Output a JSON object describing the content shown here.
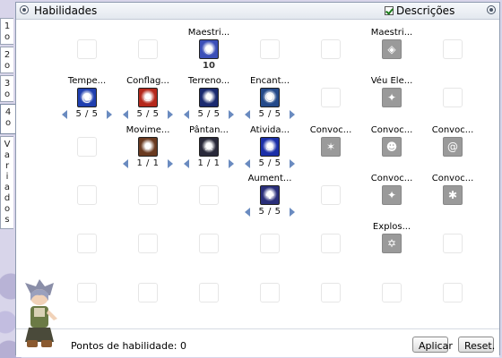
{
  "window": {
    "title": "Habilidades",
    "descricoes_label": "Descrições",
    "descricoes_checked": true
  },
  "tabs": [
    {
      "label": "1o"
    },
    {
      "label": "2o"
    },
    {
      "label": "3o"
    },
    {
      "label": "4o"
    },
    {
      "label": "Variados"
    }
  ],
  "skills": [
    {
      "name": "Maestri...",
      "level_text": "10",
      "icon": "sphere-icon",
      "color": "#3b4fb8",
      "active": true,
      "mode": "single"
    },
    {
      "name": "Maestri...",
      "level_text": "",
      "icon": "diamond-emblem-icon",
      "color": "#9a9a9a",
      "active": false,
      "mode": "none"
    },
    {
      "name": "Tempe...",
      "level_text": "5 / 5",
      "icon": "vortex-icon",
      "color": "#1f3fb0",
      "active": true,
      "mode": "range"
    },
    {
      "name": "Conflag...",
      "level_text": "5 / 5",
      "icon": "fire-icon",
      "color": "#b5281b",
      "active": true,
      "mode": "range"
    },
    {
      "name": "Terreno...",
      "level_text": "5 / 5",
      "icon": "lightning-icon",
      "color": "#1a2a70",
      "active": true,
      "mode": "range"
    },
    {
      "name": "Encant...",
      "level_text": "5 / 5",
      "icon": "spirit-icon",
      "color": "#244a8a",
      "active": true,
      "mode": "range"
    },
    {
      "name": "Véu Ele...",
      "level_text": "",
      "icon": "star-burst-icon",
      "color": "#9a9a9a",
      "active": false,
      "mode": "none"
    },
    {
      "name": "Movime...",
      "level_text": "1 / 1",
      "icon": "movement-icon",
      "color": "#6a3a20",
      "active": true,
      "mode": "range"
    },
    {
      "name": "Pântan...",
      "level_text": "1 / 1",
      "icon": "skull-icon",
      "color": "#2a2a3a",
      "active": true,
      "mode": "range"
    },
    {
      "name": "Ativida...",
      "level_text": "5 / 5",
      "icon": "blue-flame-icon",
      "color": "#1b2fa8",
      "active": true,
      "mode": "range"
    },
    {
      "name": "Convoc...",
      "level_text": "",
      "icon": "summon-fire-icon",
      "color": "#9a9a9a",
      "active": false,
      "mode": "none"
    },
    {
      "name": "Convoc...",
      "level_text": "",
      "icon": "summon-face-icon",
      "color": "#9a9a9a",
      "active": false,
      "mode": "none"
    },
    {
      "name": "Convoc...",
      "level_text": "",
      "icon": "summon-swirl-icon",
      "color": "#9a9a9a",
      "active": false,
      "mode": "none"
    },
    {
      "name": "Aument...",
      "level_text": "5 / 5",
      "icon": "cross-sparkle-icon",
      "color": "#2a2f7a",
      "active": true,
      "mode": "range"
    },
    {
      "name": "Convoc...",
      "level_text": "",
      "icon": "summon-rock-icon",
      "color": "#9a9a9a",
      "active": false,
      "mode": "none"
    },
    {
      "name": "Convoc...",
      "level_text": "",
      "icon": "summon-claw-icon",
      "color": "#9a9a9a",
      "active": false,
      "mode": "none"
    },
    {
      "name": "Explos...",
      "level_text": "",
      "icon": "hexagram-icon",
      "color": "#9a9a9a",
      "active": false,
      "mode": "none"
    }
  ],
  "footer": {
    "points_label": "Pontos de habilidade: 0",
    "apply_label": "Aplicar",
    "reset_label": "Reset."
  }
}
